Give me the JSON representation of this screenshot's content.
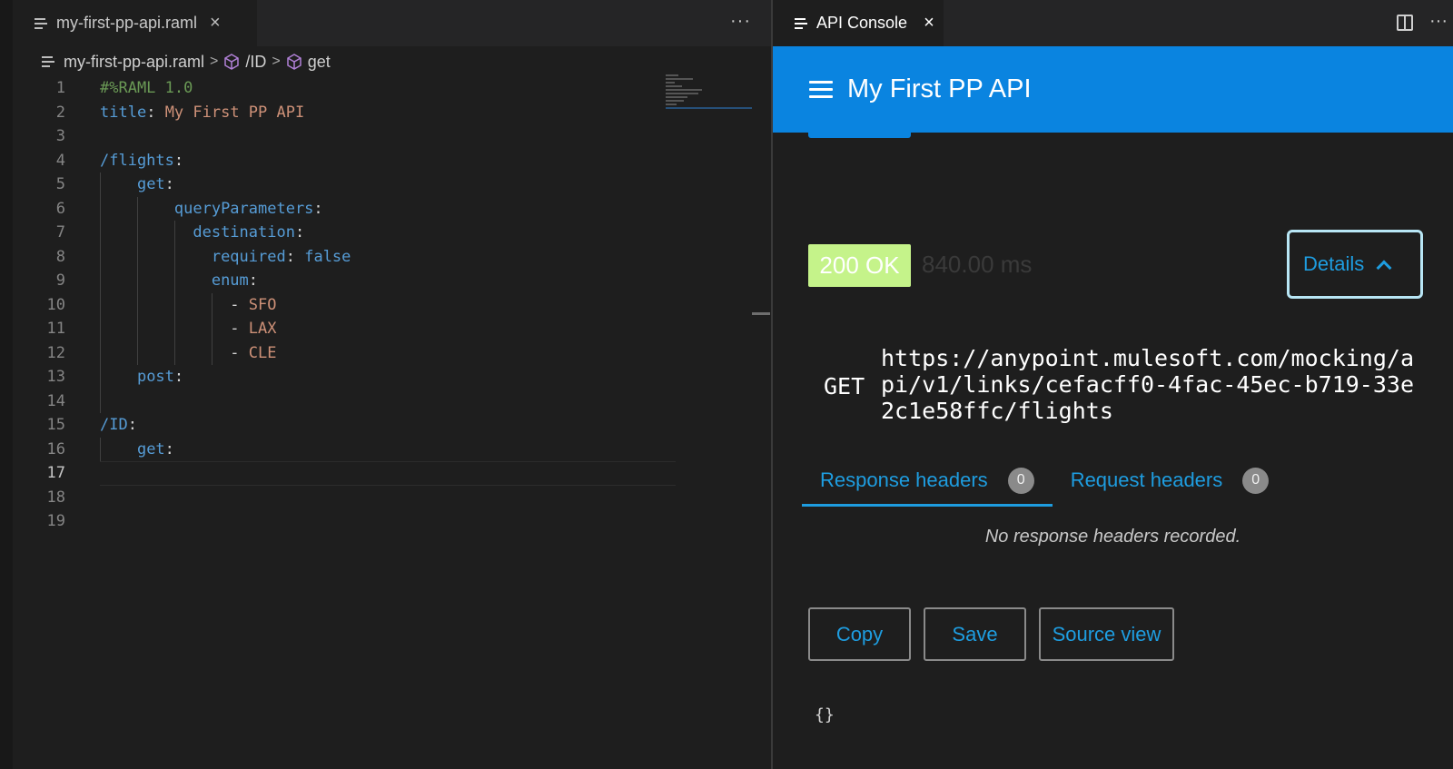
{
  "editor": {
    "tab_label": "my-first-pp-api.raml",
    "close_glyph": "×",
    "more_glyph": "···",
    "breadcrumb": {
      "file": "my-first-pp-api.raml",
      "segment_1": "/ID",
      "segment_2": "get",
      "separator": ">"
    },
    "active_line": 17,
    "lines": [
      {
        "n": "1",
        "text": "#%RAML 1.0"
      },
      {
        "n": "2",
        "text": "title: My First PP API"
      },
      {
        "n": "3",
        "text": ""
      },
      {
        "n": "4",
        "text": "/flights:"
      },
      {
        "n": "5",
        "text": "    get:"
      },
      {
        "n": "6",
        "text": "        queryParameters:"
      },
      {
        "n": "7",
        "text": "          destination:"
      },
      {
        "n": "8",
        "text": "            required: false"
      },
      {
        "n": "9",
        "text": "            enum:"
      },
      {
        "n": "10",
        "text": "              - SFO"
      },
      {
        "n": "11",
        "text": "              - LAX"
      },
      {
        "n": "12",
        "text": "              - CLE"
      },
      {
        "n": "13",
        "text": "    post:"
      },
      {
        "n": "14",
        "text": ""
      },
      {
        "n": "15",
        "text": "/ID:"
      },
      {
        "n": "16",
        "text": "    get:"
      },
      {
        "n": "17",
        "text": ""
      },
      {
        "n": "18",
        "text": ""
      },
      {
        "n": "19",
        "text": ""
      }
    ]
  },
  "console": {
    "tab_label": "API Console",
    "close_glyph": "×",
    "more_glyph": "···",
    "app_title": "My First PP API",
    "status": "200 OK",
    "time": "840.00 ms",
    "details_label": "Details",
    "method": "GET",
    "url": "https://anypoint.mulesoft.com/mocking/api/v1/links/cefacff0-4fac-45ec-b719-33e2c1e58ffc/flights",
    "tabs": [
      {
        "label": "Response headers",
        "count": "0"
      },
      {
        "label": "Request headers",
        "count": "0"
      }
    ],
    "empty_message": "No response headers recorded.",
    "actions": {
      "copy": "Copy",
      "save": "Save",
      "source_view": "Source view"
    },
    "body": "{}"
  },
  "colors": {
    "accent_blue": "#0a84e0",
    "link_blue": "#1e9de0",
    "status_green": "#c5f38a",
    "editor_bg": "#1e1e1e"
  },
  "icons": [
    "file-lines-icon",
    "close-icon",
    "more-icon",
    "cube-icon",
    "chevron-right-icon",
    "split-editor-icon",
    "hamburger-icon",
    "chevron-up-icon"
  ]
}
